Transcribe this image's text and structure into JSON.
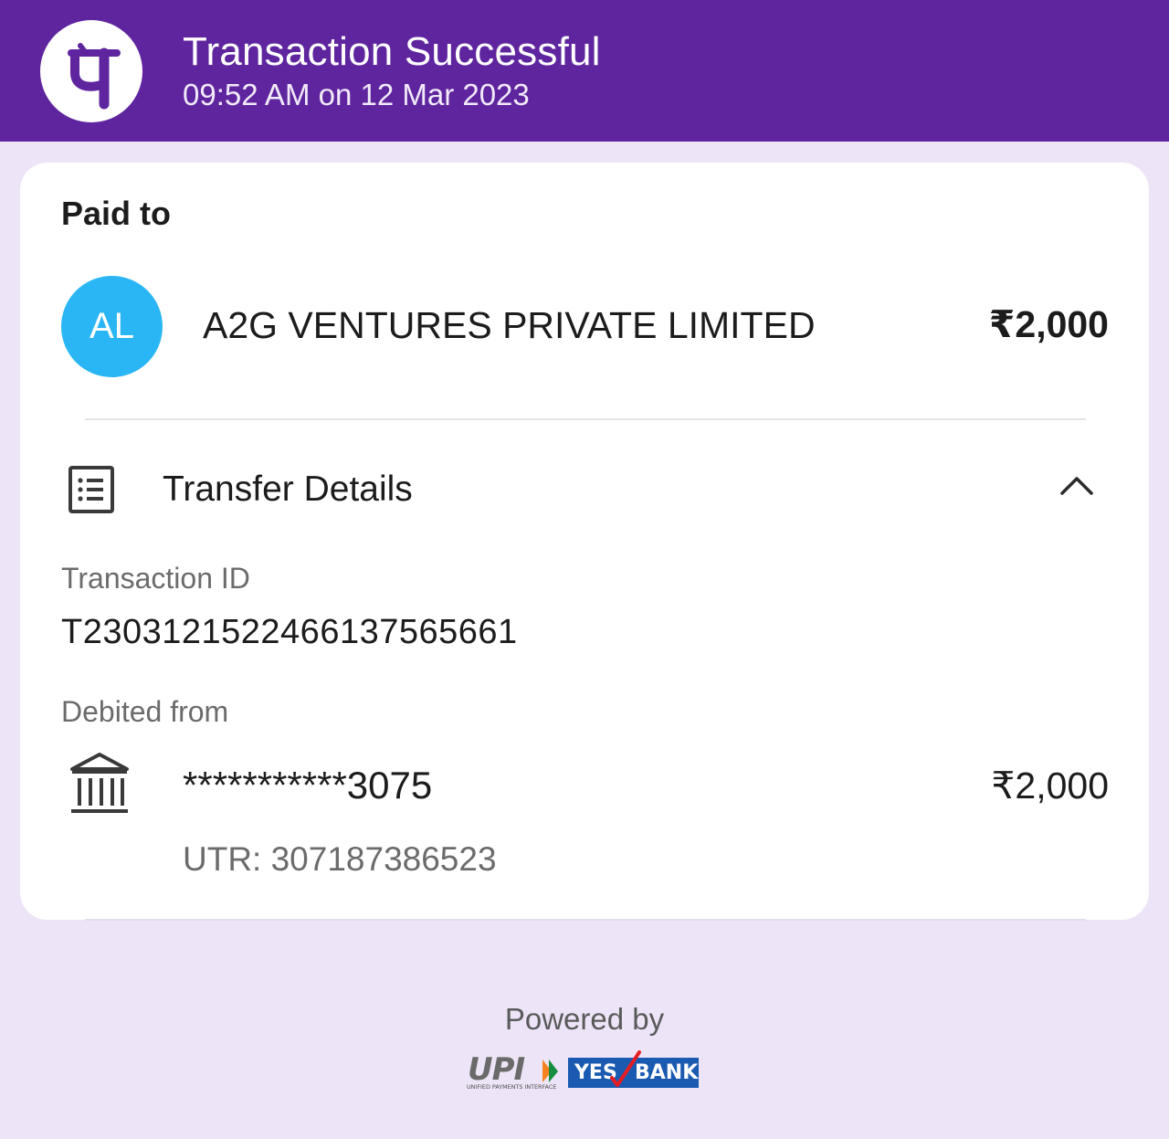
{
  "header": {
    "title": "Transaction Successful",
    "datetime": "09:52 AM on 12 Mar 2023",
    "logo_icon": "phonepe-logo-icon",
    "background": "#5f259f"
  },
  "paid_to": {
    "label": "Paid to",
    "avatar_initials": "AL",
    "avatar_color": "#2ab6f5",
    "name": "A2G VENTURES PRIVATE LIMITED",
    "amount": "₹2,000"
  },
  "transfer_details": {
    "title": "Transfer Details",
    "icon": "receipt-list-icon",
    "toggle_icon": "chevron-up-icon",
    "transaction_id_label": "Transaction ID",
    "transaction_id": "T2303121522466137565661",
    "debited_from_label": "Debited from",
    "bank_icon": "bank-icon",
    "account_number": "***********3075",
    "amount": "₹2,000",
    "utr": "UTR: 307187386523"
  },
  "footer": {
    "powered_by": "Powered by",
    "upi_logo_text": "UPI",
    "upi_logo_subtext": "UNIFIED PAYMENTS INTERFACE",
    "bank_logo_text_1": "YES",
    "bank_logo_text_2": "BANK"
  }
}
